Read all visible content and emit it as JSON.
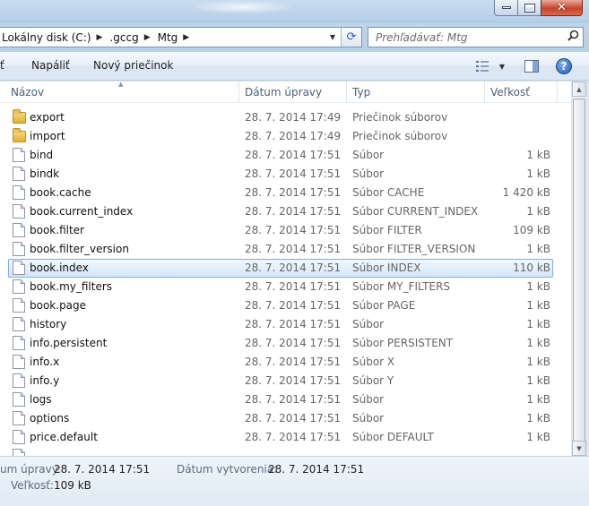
{
  "window": {
    "title": "",
    "min_glyph": "",
    "max_glyph": "",
    "close_glyph": "✕"
  },
  "address": {
    "crumbs": [
      "Lokálny disk (C:)",
      ".gccg",
      "Mtg"
    ],
    "search_placeholder": "Prehľadávať: Mtg"
  },
  "toolbar": {
    "partial_label": "ť",
    "burn_label": "Napáliť",
    "new_folder_label": "Nový priečinok",
    "help_glyph": "?"
  },
  "columns": {
    "name": "Názov",
    "date": "Dátum úpravy",
    "type": "Typ",
    "size": "Veľkosť"
  },
  "files": [
    {
      "icon": "folder",
      "name": "export",
      "date": "28. 7. 2014 17:49",
      "type": "Priečinok súborov",
      "size": ""
    },
    {
      "icon": "folder",
      "name": "import",
      "date": "28. 7. 2014 17:49",
      "type": "Priečinok súborov",
      "size": ""
    },
    {
      "icon": "file",
      "name": "bind",
      "date": "28. 7. 2014 17:51",
      "type": "Súbor",
      "size": "1 kB"
    },
    {
      "icon": "file",
      "name": "bindk",
      "date": "28. 7. 2014 17:51",
      "type": "Súbor",
      "size": "1 kB"
    },
    {
      "icon": "file",
      "name": "book.cache",
      "date": "28. 7. 2014 17:51",
      "type": "Súbor CACHE",
      "size": "1 420 kB"
    },
    {
      "icon": "file",
      "name": "book.current_index",
      "date": "28. 7. 2014 17:51",
      "type": "Súbor CURRENT_INDEX",
      "size": "1 kB"
    },
    {
      "icon": "file",
      "name": "book.filter",
      "date": "28. 7. 2014 17:51",
      "type": "Súbor FILTER",
      "size": "109 kB"
    },
    {
      "icon": "file",
      "name": "book.filter_version",
      "date": "28. 7. 2014 17:51",
      "type": "Súbor FILTER_VERSION",
      "size": "1 kB"
    },
    {
      "icon": "file",
      "name": "book.index",
      "date": "28. 7. 2014 17:51",
      "type": "Súbor INDEX",
      "size": "110 kB",
      "selected": true
    },
    {
      "icon": "file",
      "name": "book.my_filters",
      "date": "28. 7. 2014 17:51",
      "type": "Súbor MY_FILTERS",
      "size": "1 kB"
    },
    {
      "icon": "file",
      "name": "book.page",
      "date": "28. 7. 2014 17:51",
      "type": "Súbor PAGE",
      "size": "1 kB"
    },
    {
      "icon": "file",
      "name": "history",
      "date": "28. 7. 2014 17:51",
      "type": "Súbor",
      "size": "1 kB"
    },
    {
      "icon": "file",
      "name": "info.persistent",
      "date": "28. 7. 2014 17:51",
      "type": "Súbor PERSISTENT",
      "size": "1 kB"
    },
    {
      "icon": "file",
      "name": "info.x",
      "date": "28. 7. 2014 17:51",
      "type": "Súbor X",
      "size": "1 kB"
    },
    {
      "icon": "file",
      "name": "info.y",
      "date": "28. 7. 2014 17:51",
      "type": "Súbor Y",
      "size": "1 kB"
    },
    {
      "icon": "file",
      "name": "logs",
      "date": "28. 7. 2014 17:51",
      "type": "Súbor",
      "size": "1 kB"
    },
    {
      "icon": "file",
      "name": "options",
      "date": "28. 7. 2014 17:51",
      "type": "Súbor",
      "size": "1 kB"
    },
    {
      "icon": "file",
      "name": "price.default",
      "date": "28. 7. 2014 17:51",
      "type": "Súbor DEFAULT",
      "size": "1 kB"
    },
    {
      "icon": "file",
      "name": "",
      "date": "",
      "type": "",
      "size": ""
    }
  ],
  "details": {
    "modified_label": "um úpravy:",
    "modified_value": "28. 7. 2014 17:51",
    "created_label": "Dátum vytvorenia:",
    "created_value": "28. 7. 2014 17:51",
    "size_label": "Veľkosť:",
    "size_value": "109 kB"
  },
  "colors": {
    "selection_border": "#84acdd",
    "selection_fill": "#d5e6fb",
    "frame": "#bfd4ea"
  }
}
